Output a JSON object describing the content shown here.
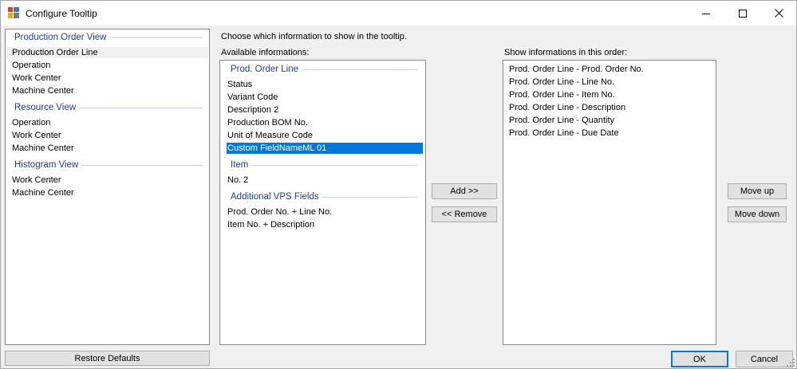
{
  "window": {
    "title": "Configure Tooltip"
  },
  "left_panel": {
    "groups": [
      {
        "header": "Production Order View",
        "items": [
          "Production Order Line",
          "Operation",
          "Work Center",
          "Machine Center"
        ]
      },
      {
        "header": "Resource View",
        "items": [
          "Operation",
          "Work Center",
          "Machine Center"
        ]
      },
      {
        "header": "Histogram View",
        "items": [
          "Work Center",
          "Machine Center"
        ]
      }
    ]
  },
  "instruction": "Choose which information to show in the tooltip.",
  "available": {
    "label": "Available informations:",
    "groups": [
      {
        "header": "Prod. Order Line",
        "items": [
          "Status",
          "Variant Code",
          "Description 2",
          "Production BOM No.",
          "Unit of Measure Code",
          "Custom FieldNameML 01"
        ]
      },
      {
        "header": "Item",
        "items": [
          "No. 2"
        ]
      },
      {
        "header": "Additional VPS Fields",
        "items": [
          "Prod. Order No. + Line No.",
          "Item No. + Description"
        ]
      }
    ]
  },
  "shown": {
    "label": "Show informations in this order:",
    "items": [
      "Prod. Order Line - Prod. Order No.",
      "Prod. Order Line - Line No.",
      "Prod. Order Line - Item No.",
      "Prod. Order Line - Description",
      "Prod. Order Line - Quantity",
      "Prod. Order Line - Due Date"
    ]
  },
  "buttons": {
    "add": "Add >>",
    "remove": "<< Remove",
    "move_up": "Move up",
    "move_down": "Move down",
    "restore_defaults": "Restore Defaults",
    "ok": "OK",
    "cancel": "Cancel"
  }
}
